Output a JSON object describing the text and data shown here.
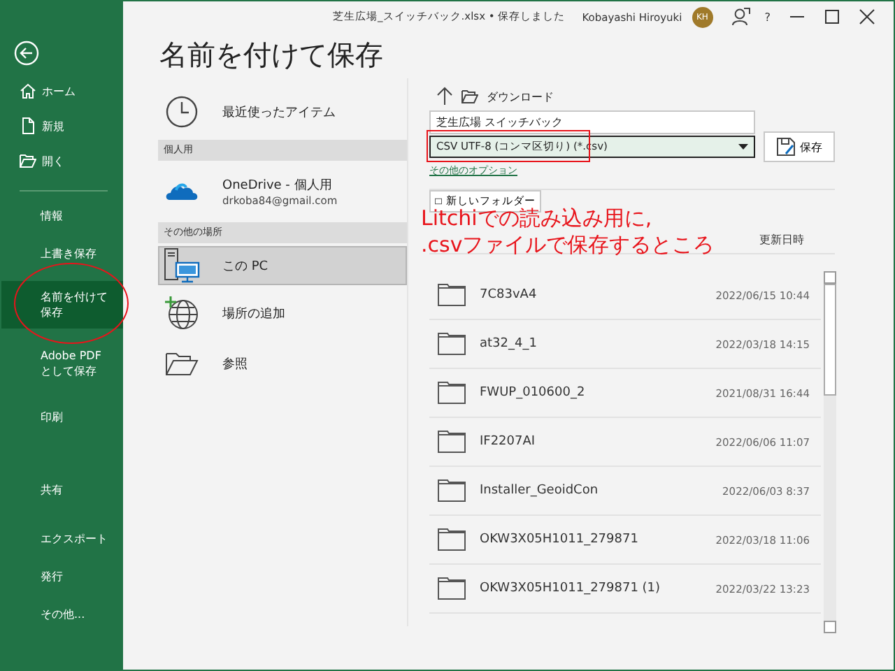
{
  "window": {
    "title": "芝生広場_スイッチバック.xlsx • 保存しました",
    "user": "Kobayashi Hiroyuki",
    "avatar": "KH",
    "help": "?"
  },
  "sidebar": {
    "nav_items": [
      {
        "label": "ホーム"
      },
      {
        "label": "新規"
      },
      {
        "label": "開く"
      }
    ],
    "items": [
      {
        "label": "情報",
        "selected": false
      },
      {
        "label": "上書き保存",
        "selected": false
      },
      {
        "label": "名前を付けて保存",
        "selected": true
      },
      {
        "label": "Adobe PDF として保存",
        "selected": false
      },
      {
        "label": "印刷",
        "selected": false
      },
      {
        "label": "共有",
        "selected": false
      },
      {
        "label": "エクスポート",
        "selected": false
      },
      {
        "label": "発行",
        "selected": false
      },
      {
        "label": "その他...",
        "selected": false
      }
    ]
  },
  "page_title": "名前を付けて保存",
  "places": [
    {
      "kind": "item",
      "label": "最近使ったアイテム",
      "selected": false
    },
    {
      "kind": "header",
      "label": "個人用"
    },
    {
      "kind": "item",
      "label": "OneDrive - 個人用",
      "detail": "drkoba84@gmail.com",
      "selected": false
    },
    {
      "kind": "header",
      "label": "その他の場所"
    },
    {
      "kind": "item",
      "label": "この PC",
      "selected": true
    },
    {
      "kind": "item",
      "label": "場所の追加",
      "selected": false
    },
    {
      "kind": "item",
      "label": "参照",
      "selected": false
    }
  ],
  "browser": {
    "path": "ダウンロード",
    "file_name": "芝生広場 スイッチバック",
    "file_type": "CSV UTF-8 (コンマ区切り) (*.csv)",
    "save_button": "保存",
    "more_options": "その他のオプション",
    "new_folder": "新しいフォルダー",
    "date_column": "更新日時",
    "rows": [
      {
        "name": "7C83vA4",
        "date": "2022/06/15 10:44"
      },
      {
        "name": "at32_4_1",
        "date": "2022/03/18 14:15"
      },
      {
        "name": "FWUP_010600_2",
        "date": "2021/08/31 16:44"
      },
      {
        "name": "IF2207AI",
        "date": "2022/06/06 11:07"
      },
      {
        "name": "Installer_GeoidCon",
        "date": "2022/06/03 8:37"
      },
      {
        "name": "OKW3X05H1011_279871",
        "date": "2022/03/18 11:06"
      },
      {
        "name": "OKW3X05H1011_279871 (1)",
        "date": "2022/03/22 13:23"
      }
    ]
  },
  "annotations": [
    {
      "kind": "ellipse"
    },
    {
      "kind": "rect"
    },
    {
      "kind": "text",
      "lines": [
        "Litchiでの読み込み用に,",
        ".csvファイルで保存するところ"
      ]
    }
  ]
}
